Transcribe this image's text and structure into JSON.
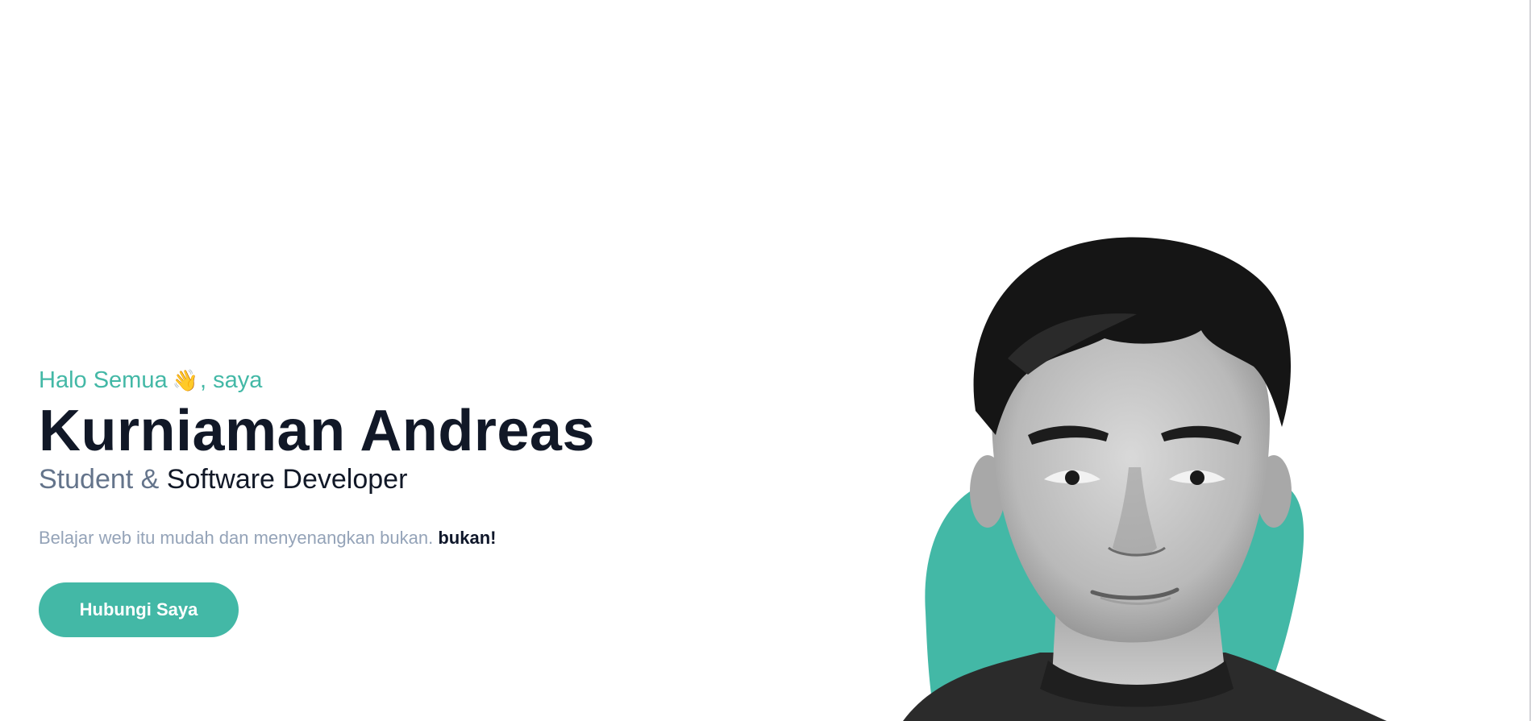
{
  "hero": {
    "greeting_text": "Halo Semua",
    "greeting_emoji": "👋",
    "greeting_suffix": ", saya",
    "name": "Kurniaman Andreas",
    "role_prefix": "Student &",
    "role_main": "Software Developer",
    "tagline": "Belajar web itu mudah dan menyenangkan bukan.",
    "tagline_emphasis": "bukan!",
    "cta_label": "Hubungi Saya"
  },
  "portrait": {
    "icon": "person-photo",
    "blob_color": "#43b8a6"
  },
  "colors": {
    "accent": "#43b8a6",
    "heading": "#111827",
    "muted": "#64748b",
    "light_muted": "#94a3b8"
  }
}
